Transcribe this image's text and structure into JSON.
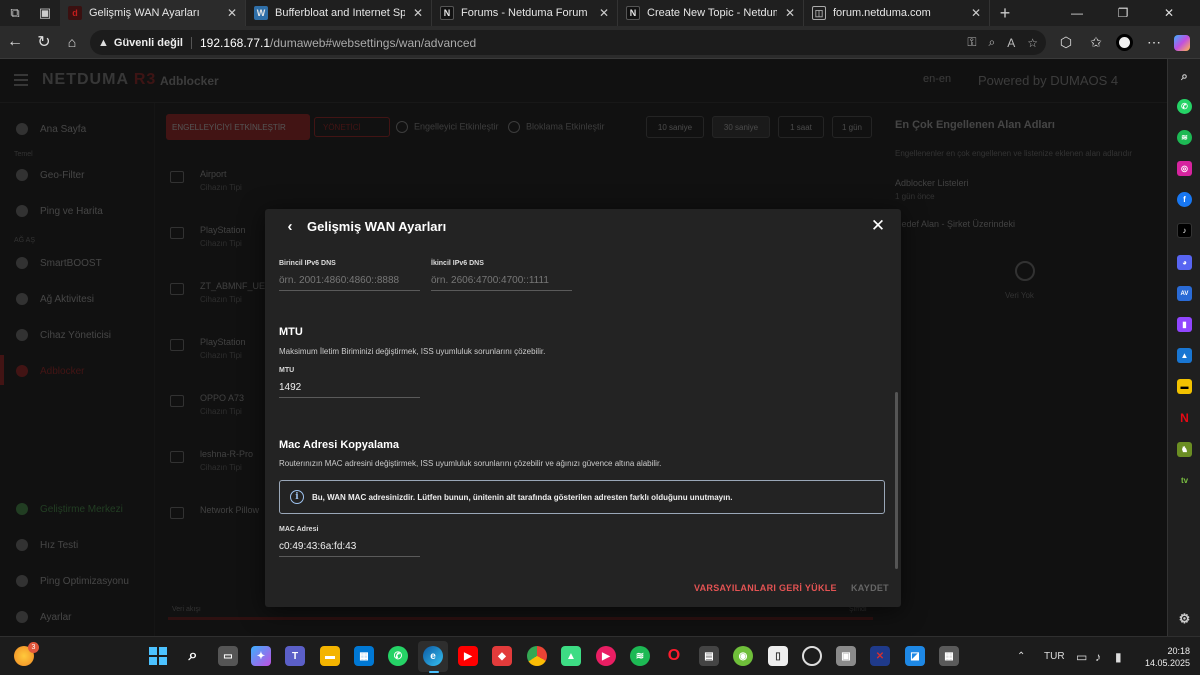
{
  "browser": {
    "tabs": [
      {
        "title": "Gelişmiş WAN Ayarları",
        "favicon": "duma-icon",
        "fav_color": "#c21d1d",
        "active": true
      },
      {
        "title": "Bufferbloat and Internet Speed Te",
        "favicon": "waveform-icon",
        "fav_color": "#2f6fa8",
        "active": false
      },
      {
        "title": "Forums - Netduma Forum",
        "favicon": "netduma-icon",
        "fav_color": "#111111",
        "active": false
      },
      {
        "title": "Create New Topic - Netduma Foru",
        "favicon": "netduma-icon",
        "fav_color": "#111111",
        "active": false
      },
      {
        "title": "forum.netduma.com",
        "favicon": "page-icon",
        "fav_color": "#444444",
        "active": false
      }
    ],
    "security_label": "Güvenli değil",
    "url_host": "192.168.77.1",
    "url_path": "/dumaweb#websettings/wan/advanced"
  },
  "app_bg": {
    "logo_a": "NETDUMA ",
    "logo_b": "R3",
    "header_sub": "Adblocker",
    "header_right_a": "en-en",
    "header_right_b": "Powered by DUMAOS 4",
    "segments": [
      "10 saniye",
      "30 saniye",
      "1 saat",
      "1 gün"
    ],
    "red_btn": "ENGELLEYİCİYİ ETKİNLEŞTİR",
    "red_btn2": "YÖNETİCİ",
    "toggle_a": "Engelleyici Etkinleştir",
    "toggle_b": "Bloklama Etkinleştir",
    "sidebar": [
      {
        "label": "Ana Sayfa"
      },
      {
        "label": "Geo-Filter"
      },
      {
        "label": "Ping ve Harita"
      },
      {
        "label": "SmartBOOST"
      },
      {
        "label": "Ağ Aktivitesi"
      },
      {
        "label": "Cihaz Yöneticisi"
      },
      {
        "label": "Adblocker"
      },
      {
        "label": "Geliştirme Merkezi"
      },
      {
        "label": "Hız Testi"
      },
      {
        "label": "Ping Optimizasyonu"
      },
      {
        "label": "Ayarlar"
      }
    ],
    "sidebar_sections": [
      "Temel",
      "AĞ AŞ"
    ],
    "rows": [
      {
        "title": "Airport",
        "sub": "Cihazın Tipi"
      },
      {
        "title": "PlayStation",
        "sub": "Cihazın Tipi"
      },
      {
        "title": "ZT_ABMNF_UE",
        "sub": "Cihazın Tipi"
      },
      {
        "title": "PlayStation",
        "sub": "Cihazın Tipi"
      },
      {
        "title": "OPPO A73",
        "sub": "Cihazın Tipi"
      },
      {
        "title": "leshna-R-Pro",
        "sub": "Cihazın Tipi"
      },
      {
        "title": "Network Pillow",
        "sub": ""
      }
    ],
    "right_panel": {
      "title": "En Çok Engellenen Alan Adları",
      "desc": "Engellenenler en çok engellenen ve listenize eklenen alan adlarıdır",
      "item": "Adblocker Listeleri",
      "item_sub": "1 gün önce",
      "sub_head": "Hedef Alan - Şirket Üzerindeki",
      "empty": "Veri Yok"
    },
    "footer_left": "Veri akışı",
    "footer_right": "Şimdi"
  },
  "modal": {
    "title": "Gelişmiş WAN Ayarları",
    "ipv6_primary_label": "Birincil IPv6 DNS",
    "ipv6_primary_placeholder": "örn. 2001:4860:4860::8888",
    "ipv6_secondary_label": "İkincil IPv6 DNS",
    "ipv6_secondary_placeholder": "örn. 2606:4700:4700::1111",
    "mtu_title": "MTU",
    "mtu_desc": "Maksimum İletim Biriminizi değiştirmek, ISS uyumluluk sorunlarını çözebilir.",
    "mtu_label": "MTU",
    "mtu_value": "1492",
    "mac_title": "Mac Adresi Kopyalama",
    "mac_desc": "Routerınızın MAC adresini değiştirmek, ISS uyumluluk sorunlarını çözebilir ve ağınızı güvence altına alabilir.",
    "info_text": "Bu, WAN MAC adresinizdir. Lütfen bunun, ünitenin alt tarafında gösterilen adresten farklı olduğunu unutmayın.",
    "mac_label": "MAC Adresi",
    "mac_value": "c0:49:43:6a:fd:43",
    "restore_label": "VARSAYILANLARI GERİ YÜKLE",
    "save_label": "KAYDET"
  },
  "sidebar_apps": [
    "search",
    "whatsapp",
    "spotify",
    "instagram",
    "facebook",
    "tiktok",
    "discord",
    "adguard",
    "twitch",
    "photos",
    "notes",
    "netflix",
    "chess",
    "tv"
  ],
  "taskbar": {
    "weather_badge": "3",
    "language": "TUR",
    "time": "20:18",
    "date": "14.05.2025"
  },
  "colors": {
    "accent_red": "#c21d1d",
    "restore_red": "#e35353",
    "modal_bg": "#232323",
    "info_border": "#9aa7b8"
  }
}
